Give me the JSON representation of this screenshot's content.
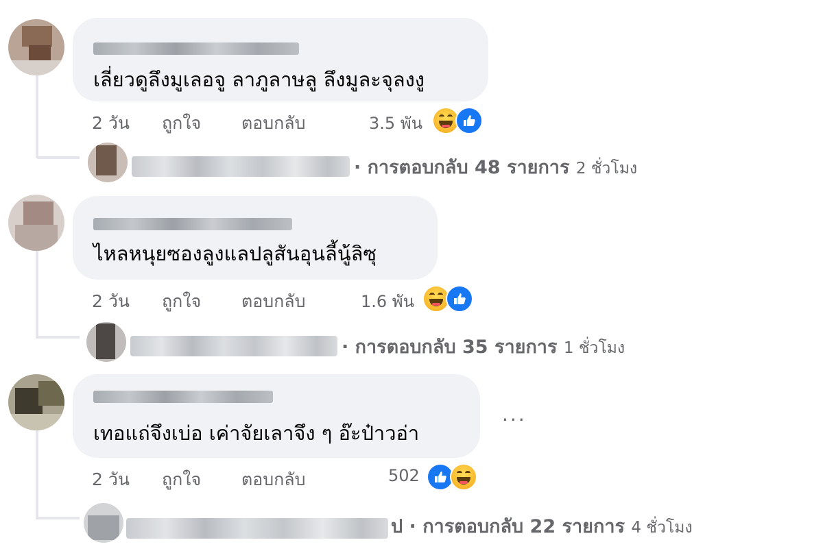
{
  "comments": [
    {
      "text": "เลี่ยวดูลึงมูเลอจู ลาภูลาษลู ลึงมูละจุลงงู",
      "actions": {
        "time": "2 วัน",
        "like": "ถูกใจ",
        "reply": "ตอบกลับ"
      },
      "reaction_count": "3.5 พัน",
      "reaction_icons": [
        "haha-icon",
        "like-icon"
      ],
      "replies": {
        "label": "· การตอบกลับ 48 รายการ",
        "time": "2 ชั่วโมง"
      }
    },
    {
      "text": "ไหลหนุยซองลูงแลปลูสันอุนลี้นู้ลิซุ",
      "actions": {
        "time": "2 วัน",
        "like": "ถูกใจ",
        "reply": "ตอบกลับ"
      },
      "reaction_count": "1.6 พัน",
      "reaction_icons": [
        "haha-icon",
        "like-icon"
      ],
      "replies": {
        "label": "· การตอบกลับ 35 รายการ",
        "time": "1 ชั่วโมง"
      }
    },
    {
      "text": "เทอแถ่จึงเบ่อ เค่าจัยเลาจึง ๆ อ๊ะป๋าวอ่า",
      "actions": {
        "time": "2 วัน",
        "like": "ถูกใจ",
        "reply": "ตอบกลับ"
      },
      "reaction_count": "502",
      "reaction_icons": [
        "like-icon",
        "haha-icon"
      ],
      "more": "...",
      "replies": {
        "label": "ป · การตอบกลับ 22 รายการ",
        "time": "4 ชั่วโมง"
      }
    }
  ],
  "colors": {
    "bubble": "#f0f2f5",
    "secondary_text": "#65676b",
    "like_blue": "#1877f2",
    "haha_yellow": "#f7b125"
  }
}
